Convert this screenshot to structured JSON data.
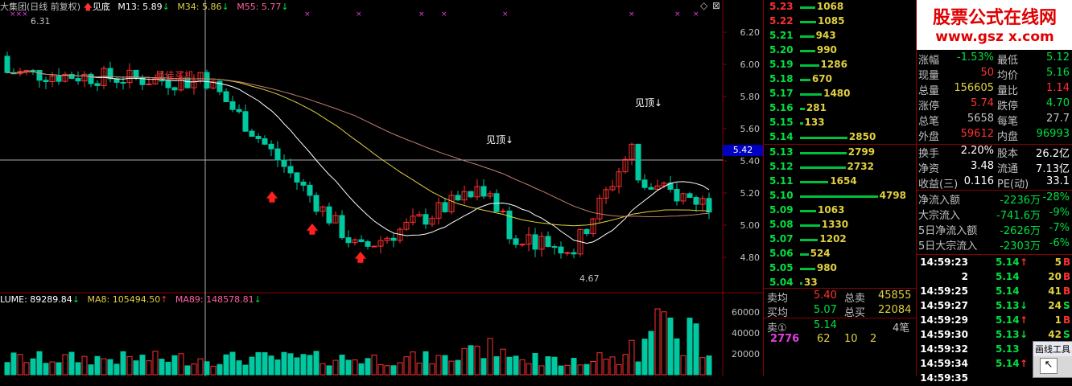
{
  "header": {
    "title": "大集团(日线 前复权)",
    "indicator_name": "见底",
    "m13": "M13: 5.89",
    "m34": "M34: 5.86",
    "m55": "M55: 5.77"
  },
  "price_axis": [
    "6.20",
    "6.00",
    "5.80",
    "5.60",
    "5.40",
    "5.20",
    "5.00",
    "4.80"
  ],
  "current_price_tag": "5.42",
  "annotations": {
    "high_label": "6.31",
    "low_label": "4.67",
    "top_signal_1": "见顶↓",
    "top_signal_2": "见顶↓",
    "buy_label": "最佳买机"
  },
  "volume_header": {
    "vol": "LUME: 89289.84",
    "ma8": "MA8: 105494.50",
    "ma89": "MA89: 148578.81"
  },
  "volume_axis": [
    "60000",
    "40000",
    "20000"
  ],
  "order_book": {
    "asks": [
      {
        "price": "5.23",
        "vol": "1068",
        "level": 0.16
      },
      {
        "price": "5.22",
        "vol": "1085",
        "level": 0.17
      },
      {
        "price": "5.21",
        "vol": "943",
        "level": 0.15
      },
      {
        "price": "5.20",
        "vol": "990",
        "level": 0.16
      },
      {
        "price": "5.19",
        "vol": "1286",
        "level": 0.2
      },
      {
        "price": "5.18",
        "vol": "670",
        "level": 0.11
      },
      {
        "price": "5.17",
        "vol": "1480",
        "level": 0.23
      },
      {
        "price": "5.16",
        "vol": "281",
        "level": 0.05
      },
      {
        "price": "5.15",
        "vol": "133",
        "level": 0.03
      },
      {
        "price": "5.14",
        "vol": "2850",
        "level": 0.5
      }
    ],
    "bids": [
      {
        "price": "5.13",
        "vol": "2799",
        "level": 0.49
      },
      {
        "price": "5.12",
        "vol": "2732",
        "level": 0.48
      },
      {
        "price": "5.11",
        "vol": "1654",
        "level": 0.3
      },
      {
        "price": "5.10",
        "vol": "4798",
        "level": 0.82
      },
      {
        "price": "5.09",
        "vol": "1063",
        "level": 0.17
      },
      {
        "price": "5.08",
        "vol": "1330",
        "level": 0.21
      },
      {
        "price": "5.07",
        "vol": "1202",
        "level": 0.19
      },
      {
        "price": "5.06",
        "vol": "524",
        "level": 0.09
      },
      {
        "price": "5.05",
        "vol": "980",
        "level": 0.16
      },
      {
        "price": "5.04",
        "vol": "33",
        "level": 0.01
      }
    ],
    "summary": {
      "sell_avg_label": "卖均",
      "sell_avg": "5.40",
      "total_sell_label": "总卖",
      "total_sell": "45855",
      "buy_avg_label": "买均",
      "buy_avg": "5.07",
      "total_buy_label": "总买",
      "total_buy": "22084"
    },
    "queue": {
      "label": "卖①",
      "price": "5.14",
      "count": "4笔",
      "q1": "2776",
      "q2": "62",
      "q3": "10",
      "q4": "2"
    }
  },
  "quote": {
    "watermark_title": "股票公式在线网",
    "watermark_url": "www.gsz x.com",
    "rows": [
      {
        "l1": "涨幅",
        "v1": "-1.53%",
        "c1": "#00e040",
        "l2": "最低",
        "v2": "5.12",
        "c2": "#00e040"
      },
      {
        "l1": "现量",
        "v1": "50",
        "c1": "#ff3030",
        "l2": "均价",
        "v2": "5.16",
        "c2": "#00e040"
      },
      {
        "l1": "总量",
        "v1": "156605",
        "c1": "#e0d040",
        "l2": "量比",
        "v2": "1.14",
        "c2": "#ff3030"
      },
      {
        "l1": "涨停",
        "v1": "5.74",
        "c1": "#ff3030",
        "l2": "跌停",
        "v2": "4.70",
        "c2": "#00e040"
      },
      {
        "l1": "总笔",
        "v1": "5658",
        "c1": "#c0c0c0",
        "l2": "每笔",
        "v2": "27.7",
        "c2": "#c0c0c0"
      },
      {
        "l1": "外盘",
        "v1": "59612",
        "c1": "#ff3030",
        "l2": "内盘",
        "v2": "96993",
        "c2": "#00e040"
      }
    ],
    "rows2": [
      {
        "l1": "换手",
        "v1": "2.20%",
        "l2": "股本",
        "v2": "26.2亿"
      },
      {
        "l1": "净资",
        "v1": "3.48",
        "l2": "流通",
        "v2": "7.13亿"
      },
      {
        "l1": "收益(三)",
        "v1": "0.116",
        "l2": "PE(动)",
        "v2": "33.1"
      }
    ],
    "flows": [
      {
        "label": "净流入额",
        "v": "-2236万",
        "p": "-28%"
      },
      {
        "label": "大宗流入",
        "v": "-741.6万",
        "p": "-9%"
      },
      {
        "label": "5日净流入额",
        "v": "-2626万",
        "p": "-7%"
      },
      {
        "label": "5日大宗流入",
        "v": "-2303万",
        "p": "-6%"
      }
    ]
  },
  "ticks": [
    {
      "t": "14:59:23",
      "p": "5.14",
      "a": "↑",
      "ac": "#ff3030",
      "v": "5",
      "d": "B",
      "dc": "#ff3030"
    },
    {
      "t": "2",
      "p": "5.14",
      "a": "",
      "ac": "#ff3030",
      "v": "20",
      "d": "B",
      "dc": "#ff3030"
    },
    {
      "t": "14:59:25",
      "p": "5.14",
      "a": "",
      "ac": "#ff3030",
      "v": "41",
      "d": "B",
      "dc": "#ff3030"
    },
    {
      "t": "14:59:27",
      "p": "5.13",
      "a": "↓",
      "ac": "#00e040",
      "v": "24",
      "d": "S",
      "dc": "#00e040"
    },
    {
      "t": "14:59:29",
      "p": "5.14",
      "a": "↑",
      "ac": "#ff3030",
      "v": "1",
      "d": "B",
      "dc": "#ff3030"
    },
    {
      "t": "14:59:30",
      "p": "5.13",
      "a": "↓",
      "ac": "#00e040",
      "v": "42",
      "d": "S",
      "dc": "#00e040"
    },
    {
      "t": "14:59:32",
      "p": "5.13",
      "a": "",
      "ac": "#00e040",
      "v": "",
      "d": "",
      "dc": "#00e040"
    },
    {
      "t": "14:59:34",
      "p": "5.14",
      "a": "↑",
      "ac": "#ff3030",
      "v": "",
      "d": "",
      "dc": "#ff3030"
    },
    {
      "t": "14:59:35",
      "p": "",
      "a": "",
      "ac": "#ff3030",
      "v": "",
      "d": "",
      "dc": "#ff3030"
    }
  ],
  "drawing_tool": {
    "title": "画线工具"
  },
  "colors": {
    "up": "#ff3030",
    "down": "#00c8a0",
    "m13": "#ffffff",
    "m34": "#e0d040",
    "m55": "#c08070",
    "grid": "#800000"
  }
}
